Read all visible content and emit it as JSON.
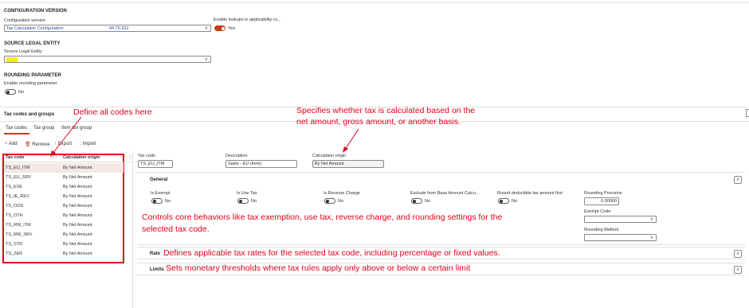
{
  "config": {
    "section_title": "CONFIGURATION VERSION",
    "config_version_label": "Configuration version",
    "config_version_value": "Tax Calculation Configuration",
    "config_version_number": "44.70.262",
    "lookups_label": "Enable lookups in applicability ru...",
    "lookups_value": "Yes"
  },
  "source": {
    "section_title": "SOURCE LEGAL ENTITY",
    "field_label": "Source Legal Entity"
  },
  "rounding": {
    "section_title": "ROUNDING PARAMETER",
    "field_label": "Enable rounding parameter",
    "value": "No"
  },
  "tax_codes_section": {
    "title": "Tax codes and groups",
    "tabs": [
      "Tax codes",
      "Tax group",
      "Item tax group"
    ],
    "actions": {
      "add": "Add",
      "remove": "Remove",
      "export": "Export",
      "import": "Import"
    }
  },
  "grid": {
    "col_code": "Tax code",
    "col_origin": "Calculation origin",
    "rows": [
      {
        "code": "TS_EU_ITM",
        "origin": "By Net Amount"
      },
      {
        "code": "TS_EU_SRV",
        "origin": "By Net Amount"
      },
      {
        "code": "TS_EXE",
        "origin": "By Net Amount"
      },
      {
        "code": "TS_IE_REV",
        "origin": "By Net Amount"
      },
      {
        "code": "TS_OOS",
        "origin": "By Net Amount"
      },
      {
        "code": "TS_OTH",
        "origin": "By Net Amount"
      },
      {
        "code": "TS_RW_ITM",
        "origin": "By Net Amount"
      },
      {
        "code": "TS_RW_SRV",
        "origin": "By Net Amount"
      },
      {
        "code": "TS_STD",
        "origin": "By Net Amount"
      },
      {
        "code": "TS_ZER",
        "origin": "By Net Amount"
      }
    ]
  },
  "detail": {
    "tax_code_label": "Tax code",
    "tax_code_value": "TS_EU_ITM",
    "description_label": "Description",
    "description_value": "Sales - EU (Item)",
    "origin_label": "Calculation origin",
    "origin_value": "By Net Amount"
  },
  "general": {
    "title": "General",
    "fields": [
      {
        "label": "Is Exempt",
        "value": "No"
      },
      {
        "label": "Is Use Tax",
        "value": "No"
      },
      {
        "label": "Is Reverse Charge",
        "value": "No"
      },
      {
        "label": "Exclude from Base Amount Calcu...",
        "value": "No"
      },
      {
        "label": "Round deductible tax amount first",
        "value": "No"
      }
    ],
    "precision_label": "Rounding Precision",
    "precision_value": "0.00000",
    "exempt_code_label": "Exempt Code",
    "rounding_method_label": "Rounding Method"
  },
  "rate": {
    "title": "Rate"
  },
  "limits": {
    "title": "Limits"
  },
  "annotations": {
    "define_codes": "Define all codes here",
    "specifies": "Specifies whether tax is calculated based on the",
    "specifies2": "net amount, gross amount, or another basis.",
    "controls": "Controls core behaviors like tax exemption, use tax, reverse charge, and rounding settings for the",
    "controls2": "selected tax code.",
    "rate_note": "Defines applicable tax rates for the selected tax code, including percentage or fixed values.",
    "limits_note": "Sets monetary thresholds where tax rules apply only above or below a certain limit"
  },
  "colors": {
    "accent": "#c43e1c",
    "annotation": "#e3001b",
    "link": "#1f4e99"
  }
}
